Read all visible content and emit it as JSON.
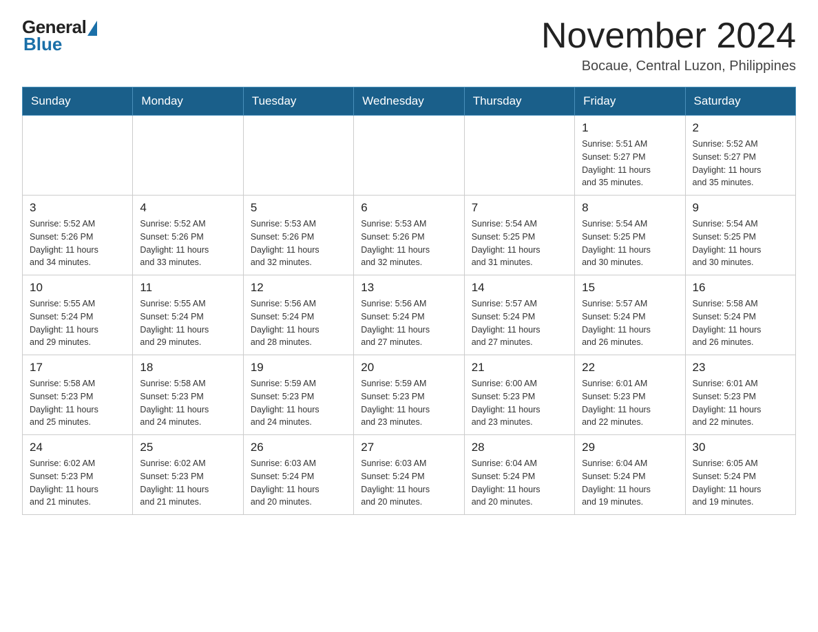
{
  "header": {
    "logo": {
      "general": "General",
      "blue": "Blue"
    },
    "title": "November 2024",
    "location": "Bocaue, Central Luzon, Philippines"
  },
  "calendar": {
    "days_of_week": [
      "Sunday",
      "Monday",
      "Tuesday",
      "Wednesday",
      "Thursday",
      "Friday",
      "Saturday"
    ],
    "weeks": [
      [
        {
          "day": "",
          "info": ""
        },
        {
          "day": "",
          "info": ""
        },
        {
          "day": "",
          "info": ""
        },
        {
          "day": "",
          "info": ""
        },
        {
          "day": "",
          "info": ""
        },
        {
          "day": "1",
          "info": "Sunrise: 5:51 AM\nSunset: 5:27 PM\nDaylight: 11 hours\nand 35 minutes."
        },
        {
          "day": "2",
          "info": "Sunrise: 5:52 AM\nSunset: 5:27 PM\nDaylight: 11 hours\nand 35 minutes."
        }
      ],
      [
        {
          "day": "3",
          "info": "Sunrise: 5:52 AM\nSunset: 5:26 PM\nDaylight: 11 hours\nand 34 minutes."
        },
        {
          "day": "4",
          "info": "Sunrise: 5:52 AM\nSunset: 5:26 PM\nDaylight: 11 hours\nand 33 minutes."
        },
        {
          "day": "5",
          "info": "Sunrise: 5:53 AM\nSunset: 5:26 PM\nDaylight: 11 hours\nand 32 minutes."
        },
        {
          "day": "6",
          "info": "Sunrise: 5:53 AM\nSunset: 5:26 PM\nDaylight: 11 hours\nand 32 minutes."
        },
        {
          "day": "7",
          "info": "Sunrise: 5:54 AM\nSunset: 5:25 PM\nDaylight: 11 hours\nand 31 minutes."
        },
        {
          "day": "8",
          "info": "Sunrise: 5:54 AM\nSunset: 5:25 PM\nDaylight: 11 hours\nand 30 minutes."
        },
        {
          "day": "9",
          "info": "Sunrise: 5:54 AM\nSunset: 5:25 PM\nDaylight: 11 hours\nand 30 minutes."
        }
      ],
      [
        {
          "day": "10",
          "info": "Sunrise: 5:55 AM\nSunset: 5:24 PM\nDaylight: 11 hours\nand 29 minutes."
        },
        {
          "day": "11",
          "info": "Sunrise: 5:55 AM\nSunset: 5:24 PM\nDaylight: 11 hours\nand 29 minutes."
        },
        {
          "day": "12",
          "info": "Sunrise: 5:56 AM\nSunset: 5:24 PM\nDaylight: 11 hours\nand 28 minutes."
        },
        {
          "day": "13",
          "info": "Sunrise: 5:56 AM\nSunset: 5:24 PM\nDaylight: 11 hours\nand 27 minutes."
        },
        {
          "day": "14",
          "info": "Sunrise: 5:57 AM\nSunset: 5:24 PM\nDaylight: 11 hours\nand 27 minutes."
        },
        {
          "day": "15",
          "info": "Sunrise: 5:57 AM\nSunset: 5:24 PM\nDaylight: 11 hours\nand 26 minutes."
        },
        {
          "day": "16",
          "info": "Sunrise: 5:58 AM\nSunset: 5:24 PM\nDaylight: 11 hours\nand 26 minutes."
        }
      ],
      [
        {
          "day": "17",
          "info": "Sunrise: 5:58 AM\nSunset: 5:23 PM\nDaylight: 11 hours\nand 25 minutes."
        },
        {
          "day": "18",
          "info": "Sunrise: 5:58 AM\nSunset: 5:23 PM\nDaylight: 11 hours\nand 24 minutes."
        },
        {
          "day": "19",
          "info": "Sunrise: 5:59 AM\nSunset: 5:23 PM\nDaylight: 11 hours\nand 24 minutes."
        },
        {
          "day": "20",
          "info": "Sunrise: 5:59 AM\nSunset: 5:23 PM\nDaylight: 11 hours\nand 23 minutes."
        },
        {
          "day": "21",
          "info": "Sunrise: 6:00 AM\nSunset: 5:23 PM\nDaylight: 11 hours\nand 23 minutes."
        },
        {
          "day": "22",
          "info": "Sunrise: 6:01 AM\nSunset: 5:23 PM\nDaylight: 11 hours\nand 22 minutes."
        },
        {
          "day": "23",
          "info": "Sunrise: 6:01 AM\nSunset: 5:23 PM\nDaylight: 11 hours\nand 22 minutes."
        }
      ],
      [
        {
          "day": "24",
          "info": "Sunrise: 6:02 AM\nSunset: 5:23 PM\nDaylight: 11 hours\nand 21 minutes."
        },
        {
          "day": "25",
          "info": "Sunrise: 6:02 AM\nSunset: 5:23 PM\nDaylight: 11 hours\nand 21 minutes."
        },
        {
          "day": "26",
          "info": "Sunrise: 6:03 AM\nSunset: 5:24 PM\nDaylight: 11 hours\nand 20 minutes."
        },
        {
          "day": "27",
          "info": "Sunrise: 6:03 AM\nSunset: 5:24 PM\nDaylight: 11 hours\nand 20 minutes."
        },
        {
          "day": "28",
          "info": "Sunrise: 6:04 AM\nSunset: 5:24 PM\nDaylight: 11 hours\nand 20 minutes."
        },
        {
          "day": "29",
          "info": "Sunrise: 6:04 AM\nSunset: 5:24 PM\nDaylight: 11 hours\nand 19 minutes."
        },
        {
          "day": "30",
          "info": "Sunrise: 6:05 AM\nSunset: 5:24 PM\nDaylight: 11 hours\nand 19 minutes."
        }
      ]
    ]
  }
}
